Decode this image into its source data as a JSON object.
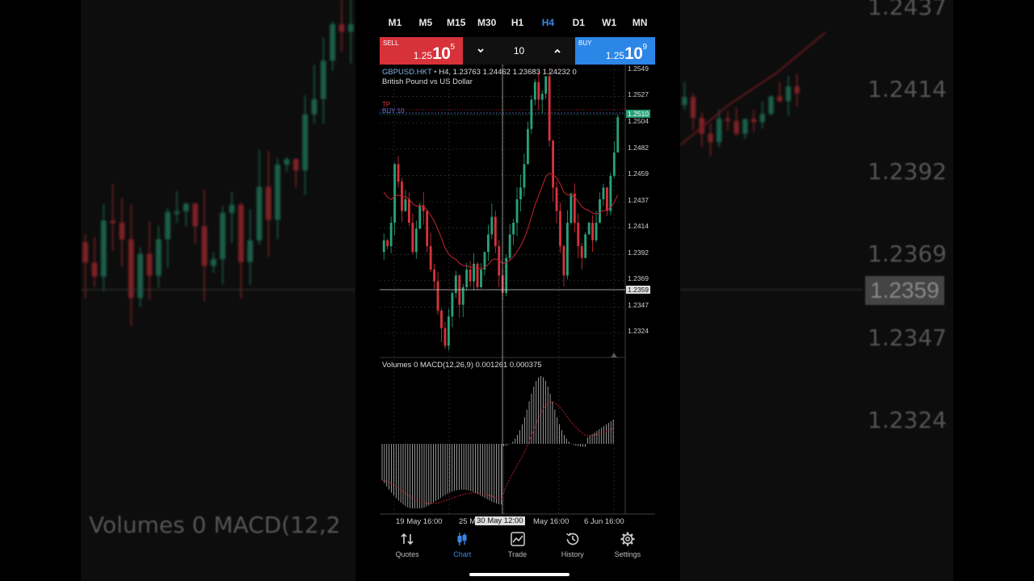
{
  "background": {
    "left_visible": true,
    "right_prices": [
      "1.2437",
      "1.2414",
      "1.2392",
      "1.2369",
      "1.2359",
      "1.2347",
      "1.2324"
    ],
    "left_caption": "Volumes 0 MACD(12,2"
  },
  "timeframes": [
    {
      "label": "M1",
      "active": false
    },
    {
      "label": "M5",
      "active": false
    },
    {
      "label": "M15",
      "active": false
    },
    {
      "label": "M30",
      "active": false
    },
    {
      "label": "H1",
      "active": false
    },
    {
      "label": "H4",
      "active": true
    },
    {
      "label": "D1",
      "active": false
    },
    {
      "label": "W1",
      "active": false
    },
    {
      "label": "MN",
      "active": false
    }
  ],
  "trade": {
    "sell_label": "SELL",
    "sell_price_prefix": "1.25",
    "sell_price_big": "10",
    "sell_price_sup": "5",
    "buy_label": "BUY",
    "buy_price_prefix": "1.25",
    "buy_price_big": "10",
    "buy_price_sup": "9",
    "volume": "10"
  },
  "chart": {
    "symbol": "GBPUSD.HKT",
    "dot": "•",
    "ohlc": "H4, 1.23763 1.24462 1.23683 1.24232 0",
    "description": "British Pound vs US Dollar",
    "tp_label": "TP",
    "buy_order_label": "BUY 10",
    "indicator_label": "Volumes 0 MACD(12,26,9) 0.001261 0.000375",
    "y_labels": [
      "1.2549",
      "1.2527",
      "1.2504",
      "1.2482",
      "1.2459",
      "1.2437",
      "1.2414",
      "1.2392",
      "1.2369",
      "1.2347",
      "1.2324"
    ],
    "current_price_tag": "1.2510",
    "crosshair_price_tag": "1.2359",
    "x_labels": [
      "19 May 16:00",
      "25 M",
      "May 16:00",
      "6 Jun 16:00"
    ],
    "crosshair_time_tag": "30 May 12:00",
    "colors": {
      "bull": "#27a17a",
      "bear": "#d7323a",
      "ma": "#b5222d",
      "grid": "#3a3a3a"
    }
  },
  "chart_data": {
    "type": "candlestick",
    "symbol": "GBPUSD.HKT",
    "timeframe": "H4",
    "ylim": [
      1.2305,
      1.2555
    ],
    "closes": [
      1.2405,
      1.24,
      1.242,
      1.247,
      1.2455,
      1.243,
      1.244,
      1.242,
      1.2395,
      1.2415,
      1.2435,
      1.243,
      1.24,
      1.238,
      1.237,
      1.2345,
      1.233,
      1.2315,
      1.234,
      1.236,
      1.2375,
      1.235,
      1.2365,
      1.238,
      1.237,
      1.2385,
      1.2365,
      1.238,
      1.2395,
      1.241,
      1.2425,
      1.24,
      1.2375,
      1.236,
      1.239,
      1.241,
      1.242,
      1.244,
      1.245,
      1.247,
      1.25,
      1.2525,
      1.254,
      1.2525,
      1.253,
      1.2545,
      1.249,
      1.245,
      1.243,
      1.24,
      1.2375,
      1.242,
      1.2445,
      1.242,
      1.24,
      1.239,
      1.241,
      1.242,
      1.2405,
      1.242,
      1.244,
      1.245,
      1.243,
      1.246,
      1.248,
      1.251
    ],
    "moving_average": "red line",
    "macd": {
      "label": "MACD(12,26,9)",
      "main": 0.001261,
      "signal": 0.000375
    }
  },
  "nav": [
    {
      "label": "Quotes",
      "icon": "quotes-icon",
      "active": false
    },
    {
      "label": "Chart",
      "icon": "chart-icon",
      "active": true
    },
    {
      "label": "Trade",
      "icon": "trade-icon",
      "active": false
    },
    {
      "label": "History",
      "icon": "history-icon",
      "active": false
    },
    {
      "label": "Settings",
      "icon": "settings-icon",
      "active": false
    }
  ]
}
